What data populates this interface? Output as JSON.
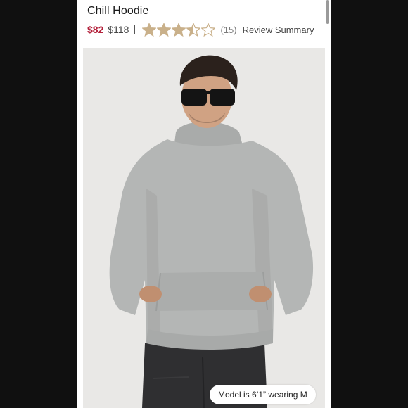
{
  "product": {
    "title": "Chill Hoodie",
    "sale_price": "$82",
    "original_price": "$118",
    "rating": 3.5,
    "rating_max": 5,
    "review_count": "(15)",
    "review_link": "Review Summary"
  },
  "image": {
    "model_badge": "Model is 6’1” wearing M"
  },
  "icons": {
    "star": "star-icon"
  },
  "colors": {
    "sale": "#b3203a",
    "star_filled": "#c9b08a",
    "star_empty": "#c9b08a",
    "hoodie": "#b4b6b5",
    "background": "#e9e8e6"
  }
}
